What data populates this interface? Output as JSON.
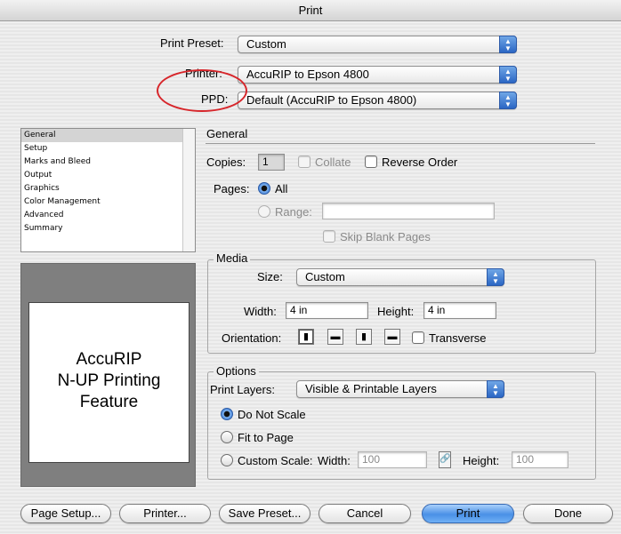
{
  "window": {
    "title": "Print"
  },
  "header": {
    "preset_label": "Print Preset:",
    "preset_value": "Custom",
    "printer_label": "Printer:",
    "printer_value": "AccuRIP to Epson 4800",
    "ppd_label": "PPD:",
    "ppd_value": "Default (AccuRIP to Epson 4800)"
  },
  "sidebar": {
    "items": [
      {
        "label": "General",
        "selected": true
      },
      {
        "label": "Setup"
      },
      {
        "label": "Marks and Bleed"
      },
      {
        "label": "Output"
      },
      {
        "label": "Graphics"
      },
      {
        "label": "Color Management"
      },
      {
        "label": "Advanced"
      },
      {
        "label": "Summary"
      }
    ]
  },
  "preview": {
    "line1": "AccuRIP",
    "line2": "N-UP Printing",
    "line3": "Feature"
  },
  "general": {
    "title": "General",
    "copies_label": "Copies:",
    "copies_value": "1",
    "collate_label": "Collate",
    "reverse_label": "Reverse Order",
    "pages_label": "Pages:",
    "all_label": "All",
    "range_label": "Range:",
    "range_value": "",
    "skip_label": "Skip Blank Pages"
  },
  "media": {
    "title": "Media",
    "size_label": "Size:",
    "size_value": "Custom",
    "width_label": "Width:",
    "width_value": "4 in",
    "height_label": "Height:",
    "height_value": "4 in",
    "orientation_label": "Orientation:",
    "transverse_label": "Transverse"
  },
  "options": {
    "title": "Options",
    "layers_label": "Print Layers:",
    "layers_value": "Visible & Printable Layers",
    "no_scale_label": "Do Not Scale",
    "fit_label": "Fit to Page",
    "custom_label": "Custom Scale:",
    "cs_width_label": "Width:",
    "cs_width_value": "100",
    "cs_height_label": "Height:",
    "cs_height_value": "100"
  },
  "footer": {
    "page_setup": "Page Setup...",
    "printer": "Printer...",
    "save_preset": "Save Preset...",
    "cancel": "Cancel",
    "print": "Print",
    "done": "Done"
  },
  "colors": {
    "accent": "#4a90e6",
    "annotation": "#d7262b"
  }
}
